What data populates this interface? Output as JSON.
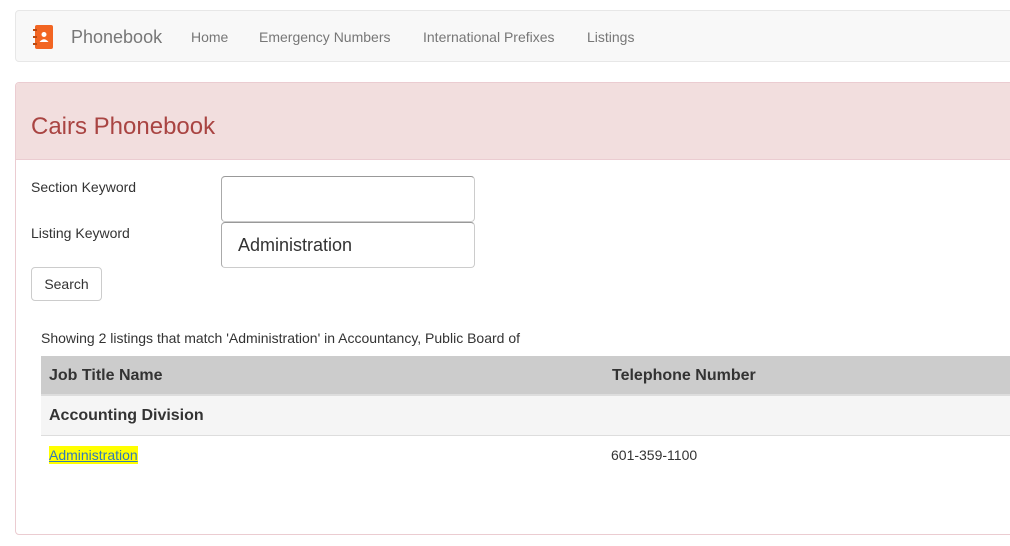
{
  "colors": {
    "brand_icon": "#f26522",
    "panel_heading_bg": "#f2dede",
    "panel_title": "#a94442",
    "highlight": "#ffff00",
    "table_header_bg": "#cccccc"
  },
  "navbar": {
    "brand_icon": "phonebook-icon",
    "brand": "Phonebook",
    "links": [
      "Home",
      "Emergency Numbers",
      "International Prefixes",
      "Listings"
    ]
  },
  "panel": {
    "title": "Cairs Phonebook"
  },
  "form": {
    "section_label": "Section Keyword",
    "section_value": "",
    "listing_label": "Listing Keyword",
    "listing_value": "Administration",
    "search_label": "Search"
  },
  "results": {
    "summary": "Showing 2 listings that match 'Administration' in Accountancy, Public Board of",
    "columns": [
      "Job Title Name",
      "Telephone Number"
    ],
    "groups": [
      {
        "name": "Accounting Division",
        "rows": [
          {
            "title": "Administration",
            "phone": "601-359-1100"
          }
        ]
      }
    ]
  }
}
